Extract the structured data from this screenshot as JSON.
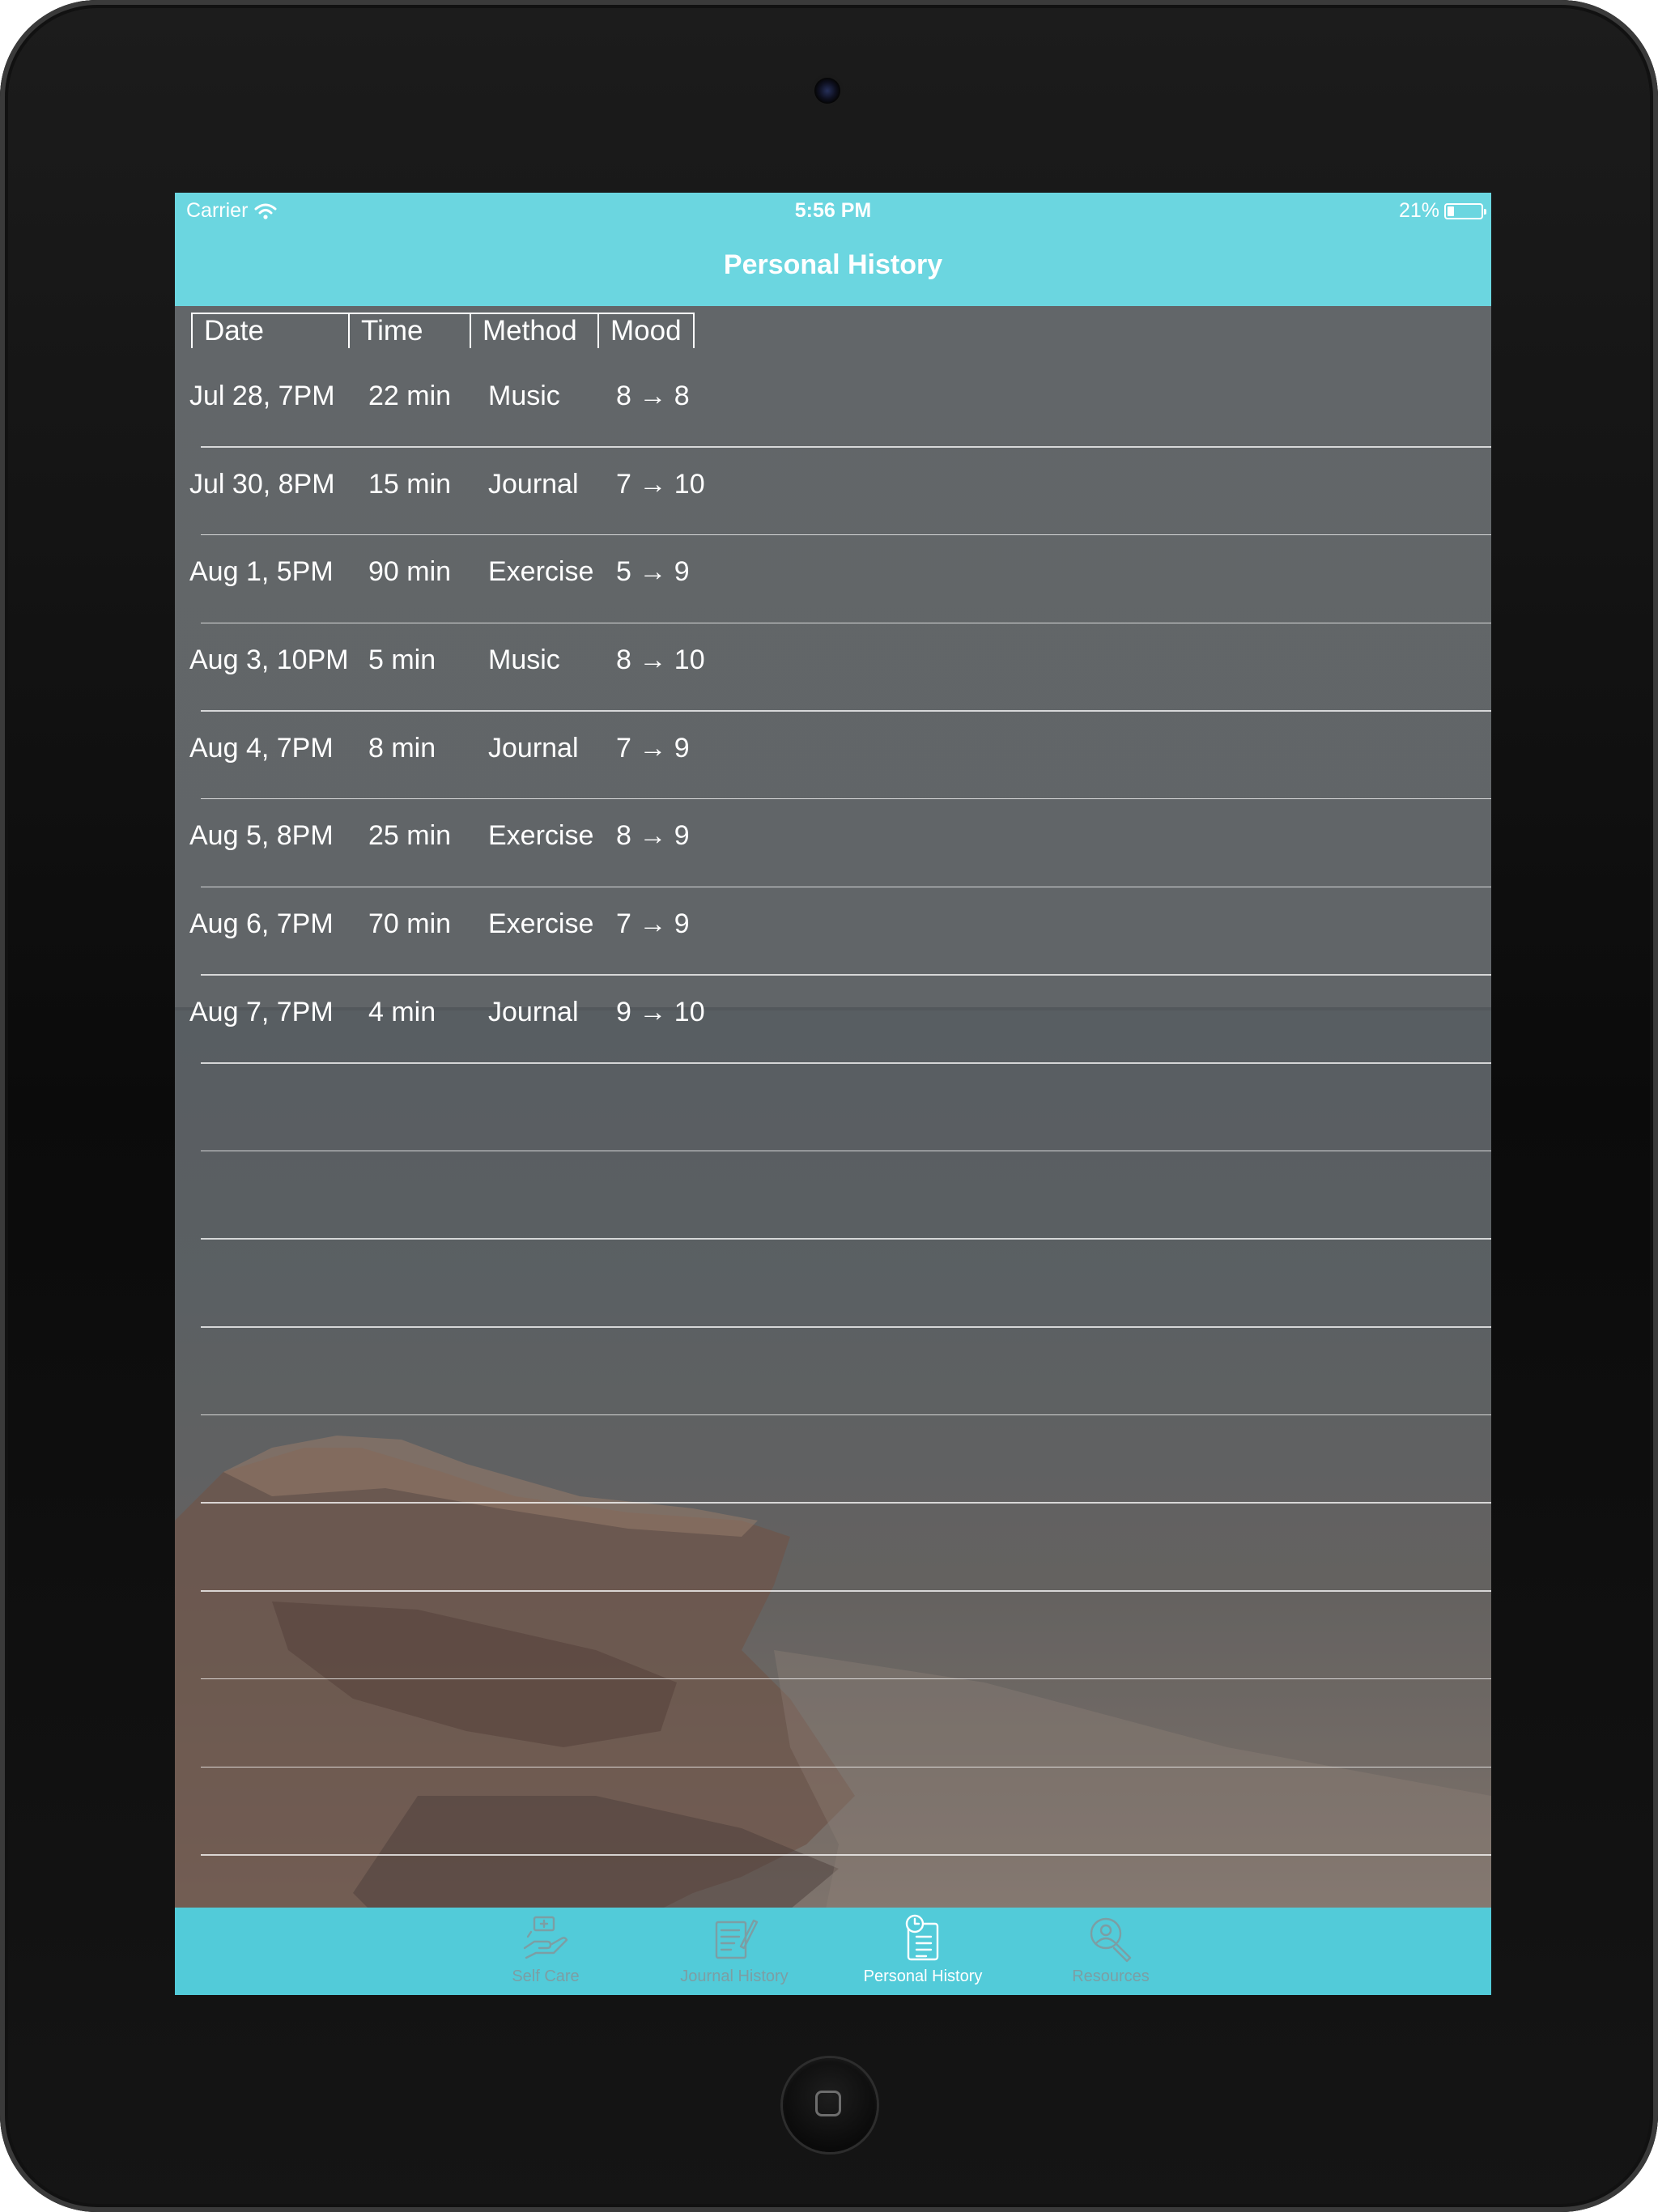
{
  "status_bar": {
    "carrier": "Carrier",
    "time": "5:56 PM",
    "battery_text": "21%",
    "battery_level": 0.21
  },
  "nav": {
    "title": "Personal History"
  },
  "table": {
    "headers": [
      "Date",
      "Time",
      "Method",
      "Mood"
    ],
    "rows": [
      {
        "date": "Jul 28, 7PM",
        "time": "22 min",
        "method": "Music",
        "mood": "8 → 8"
      },
      {
        "date": "Jul 30, 8PM",
        "time": "15 min",
        "method": "Journal",
        "mood": "7 → 10"
      },
      {
        "date": "Aug 1, 5PM",
        "time": "90 min",
        "method": "Exercise",
        "mood": "5 → 9"
      },
      {
        "date": "Aug 3, 10PM",
        "time": "5 min",
        "method": "Music",
        "mood": "8 → 10"
      },
      {
        "date": "Aug 4, 7PM",
        "time": "8 min",
        "method": "Journal",
        "mood": "7 → 9"
      },
      {
        "date": "Aug 5, 8PM",
        "time": "25 min",
        "method": "Exercise",
        "mood": "8 → 9"
      },
      {
        "date": "Aug 6, 7PM",
        "time": "70 min",
        "method": "Exercise",
        "mood": "7 → 9"
      },
      {
        "date": "Aug 7, 7PM",
        "time": "4 min",
        "method": "Journal",
        "mood": "9 → 10"
      },
      {
        "date": "",
        "time": "",
        "method": "",
        "mood": ""
      },
      {
        "date": "",
        "time": "",
        "method": "",
        "mood": ""
      },
      {
        "date": "",
        "time": "",
        "method": "",
        "mood": ""
      },
      {
        "date": "",
        "time": "",
        "method": "",
        "mood": ""
      },
      {
        "date": "",
        "time": "",
        "method": "",
        "mood": ""
      },
      {
        "date": "",
        "time": "",
        "method": "",
        "mood": ""
      },
      {
        "date": "",
        "time": "",
        "method": "",
        "mood": ""
      },
      {
        "date": "",
        "time": "",
        "method": "",
        "mood": ""
      },
      {
        "date": "",
        "time": "",
        "method": "",
        "mood": ""
      },
      {
        "date": "",
        "time": "",
        "method": "",
        "mood": ""
      }
    ]
  },
  "tabbar": {
    "tabs": [
      {
        "label": "Self Care",
        "icon": "self-care-icon",
        "active": false
      },
      {
        "label": "Journal History",
        "icon": "journal-icon",
        "active": false
      },
      {
        "label": "Personal History",
        "icon": "clipboard-clock-icon",
        "active": true
      },
      {
        "label": "Resources",
        "icon": "person-search-icon",
        "active": false
      }
    ]
  },
  "colors": {
    "nav_bar": "#6bd6e0",
    "tab_bar": "#52cbd9",
    "tab_inactive": "#7c9ea4",
    "tab_active": "#ffffff"
  }
}
